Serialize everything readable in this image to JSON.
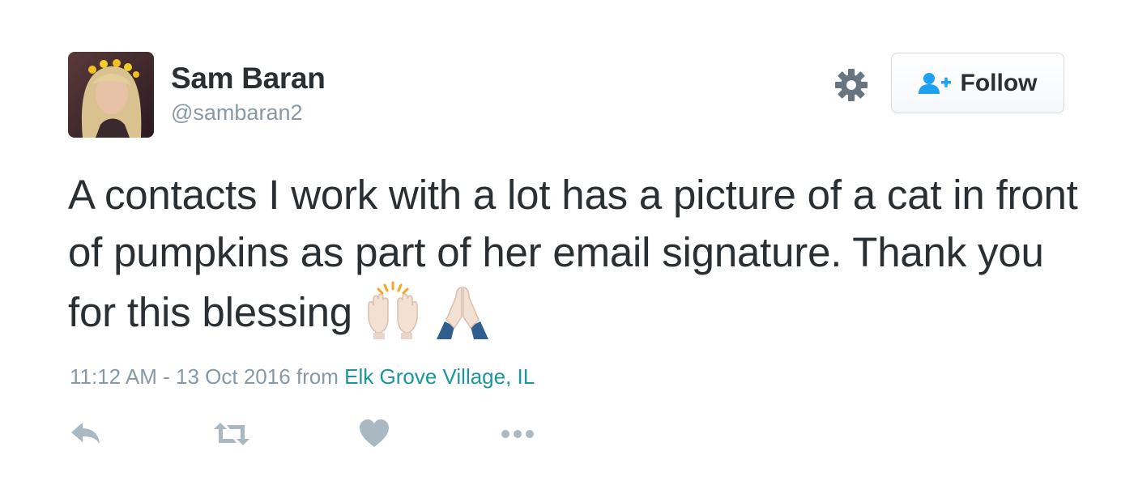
{
  "tweet": {
    "author": {
      "name": "Sam Baran",
      "handle": "@sambaran2"
    },
    "follow_label": "Follow",
    "text": "A contacts I work with a lot has a picture of a cat in front of pumpkins as part of her email signature. Thank you for this blessing",
    "emojis": [
      "raising-hands-icon",
      "folded-hands-icon"
    ],
    "time": "11:12 AM - 13 Oct 2016",
    "from_text": "from",
    "location": "Elk Grove Village, IL",
    "actions": [
      "reply-icon",
      "retweet-icon",
      "like-icon",
      "more-icon"
    ]
  },
  "colors": {
    "text": "#292f33",
    "muted": "#8899a6",
    "location": "#1b95a0",
    "follow_icon": "#1da1f2",
    "action_icon": "#aab8c2"
  }
}
